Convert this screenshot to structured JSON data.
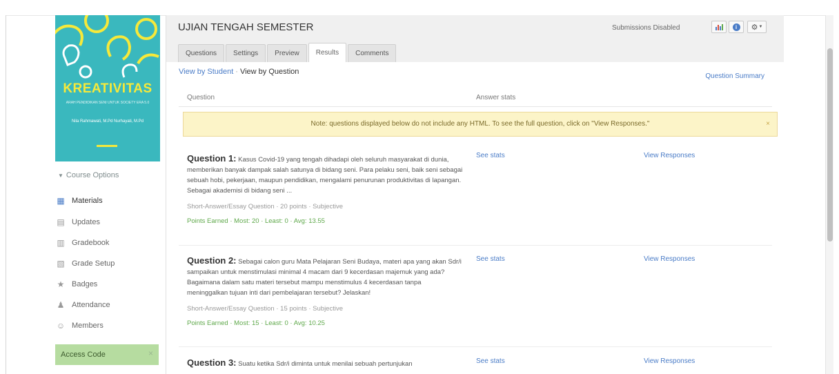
{
  "sidebar": {
    "cover": {
      "title": "KREATIVITAS",
      "subtitle": "ARAH PENDIDIKAN SENI UNTUK SOCIETY ERA 5.0",
      "author": "Nila Rahmawati, M.Pd Nurhayati, M.Pd"
    },
    "course_options": "Course Options",
    "items": [
      {
        "label": "Materials",
        "icon": "materials-icon"
      },
      {
        "label": "Updates",
        "icon": "updates-icon"
      },
      {
        "label": "Gradebook",
        "icon": "gradebook-icon"
      },
      {
        "label": "Grade Setup",
        "icon": "grade-setup-icon"
      },
      {
        "label": "Badges",
        "icon": "badge-icon"
      },
      {
        "label": "Attendance",
        "icon": "attendance-icon"
      },
      {
        "label": "Members",
        "icon": "members-icon"
      }
    ],
    "access_code": "Access Code"
  },
  "header": {
    "title": "UJIAN TENGAH SEMESTER",
    "submissions": "Submissions Disabled",
    "tabs": [
      "Questions",
      "Settings",
      "Preview",
      "Results",
      "Comments"
    ],
    "active_tab": "Results"
  },
  "results": {
    "view_by_student": "View by Student",
    "view_by_question": "View by Question",
    "question_summary": "Question Summary",
    "col_question": "Question",
    "col_answer_stats": "Answer stats",
    "note": "Note: questions displayed below do not include any HTML. To see the full question, click on \"View Responses.\"",
    "see_stats": "See stats",
    "view_responses": "View Responses",
    "questions": [
      {
        "label": "Question 1:",
        "text": "Kasus Covid-19 yang tengah dihadapi oleh seluruh masyarakat di dunia, memberikan banyak dampak salah satunya di bidang seni. Para pelaku seni, baik seni sebagai sebuah hobi, pekerjaan, maupun pendidikan, mengalami penurunan produktivitas di lapangan. Sebagai akademisi di bidang seni ...",
        "meta": "Short-Answer/Essay Question · 20 points · Subjective",
        "points": "Points Earned · Most: 20 · Least: 0 · Avg: 13.55"
      },
      {
        "label": "Question 2:",
        "text": "Sebagai calon guru Mata Pelajaran Seni Budaya, materi apa yang akan Sdr/i sampaikan untuk menstimulasi minimal 4 macam dari 9 kecerdasan majemuk yang ada? Bagaimana dalam satu materi tersebut mampu menstimulus 4 kecerdasan tanpa meninggalkan tujuan inti dari pembelajaran tersebut? Jelaskan!",
        "meta": "Short-Answer/Essay Question · 15 points · Subjective",
        "points": "Points Earned · Most: 15 · Least: 0 · Avg: 10.25"
      },
      {
        "label": "Question 3:",
        "text": "Suatu ketika Sdr/i diminta untuk menilai sebuah pertunjukan",
        "meta": "",
        "points": ""
      }
    ]
  },
  "colors": {
    "cover_bg": "#3ab8be",
    "cover_title": "#f6e93a",
    "link": "#4a7cc7",
    "note_bg": "#fcf4c8",
    "points_green": "#5ea84a",
    "access_code_bg": "#b6dca0"
  }
}
